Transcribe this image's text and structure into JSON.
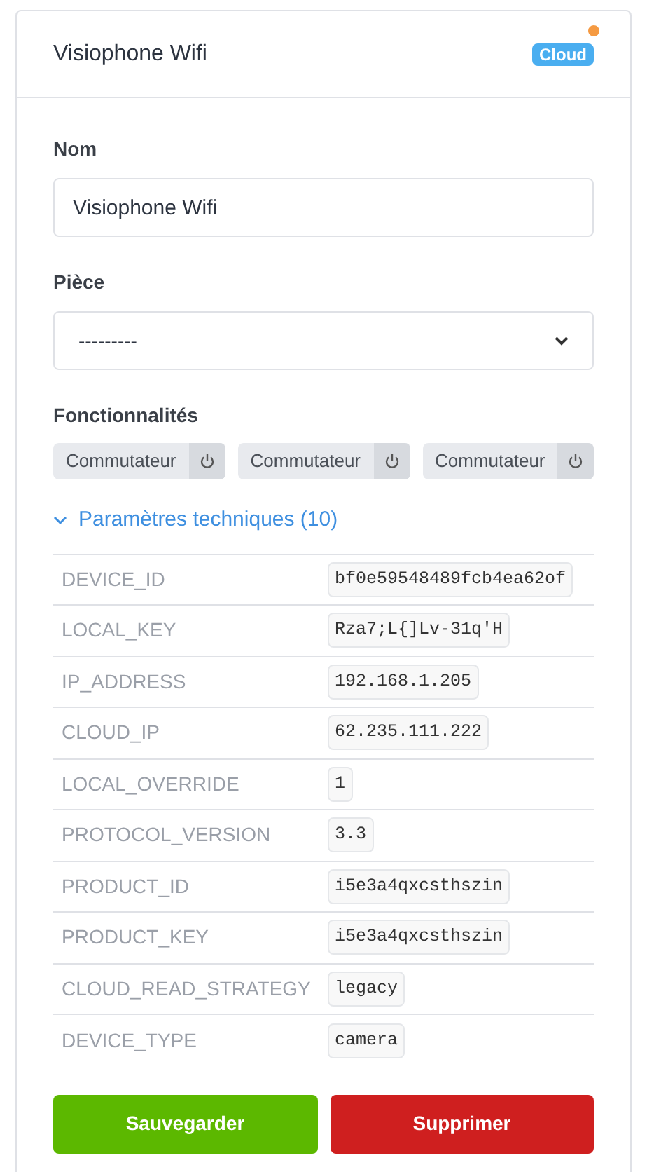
{
  "header": {
    "title": "Visiophone Wifi",
    "badge": {
      "label": "Cloud",
      "notification": true
    }
  },
  "name_field": {
    "label": "Nom",
    "value": "Visiophone Wifi"
  },
  "room_select": {
    "label": "Pièce",
    "value": "---------"
  },
  "features": {
    "label": "Fonctionnalités",
    "items": [
      {
        "label": "Commutateur",
        "on": false
      },
      {
        "label": "Commutateur",
        "on": false
      },
      {
        "label": "Commutateur",
        "on": false
      }
    ]
  },
  "technical": {
    "title": "Paramètres techniques (10)",
    "expanded": true,
    "rows": [
      {
        "key": "DEVICE_ID",
        "value": "bf0e59548489fcb4ea62of"
      },
      {
        "key": "LOCAL_KEY",
        "value": "Rza7;L{]Lv-31q'H"
      },
      {
        "key": "IP_ADDRESS",
        "value": "192.168.1.205"
      },
      {
        "key": "CLOUD_IP",
        "value": "62.235.111.222"
      },
      {
        "key": "LOCAL_OVERRIDE",
        "value": "1"
      },
      {
        "key": "PROTOCOL_VERSION",
        "value": "3.3"
      },
      {
        "key": "PRODUCT_ID",
        "value": "i5e3a4qxcsthszin"
      },
      {
        "key": "PRODUCT_KEY",
        "value": "i5e3a4qxcsthszin"
      },
      {
        "key": "CLOUD_READ_STRATEGY",
        "value": "legacy"
      },
      {
        "key": "DEVICE_TYPE",
        "value": "camera"
      }
    ]
  },
  "buttons": [
    {
      "label": "Sauvegarder",
      "kind": "save"
    },
    {
      "label": "Supprimer",
      "kind": "delete"
    }
  ]
}
